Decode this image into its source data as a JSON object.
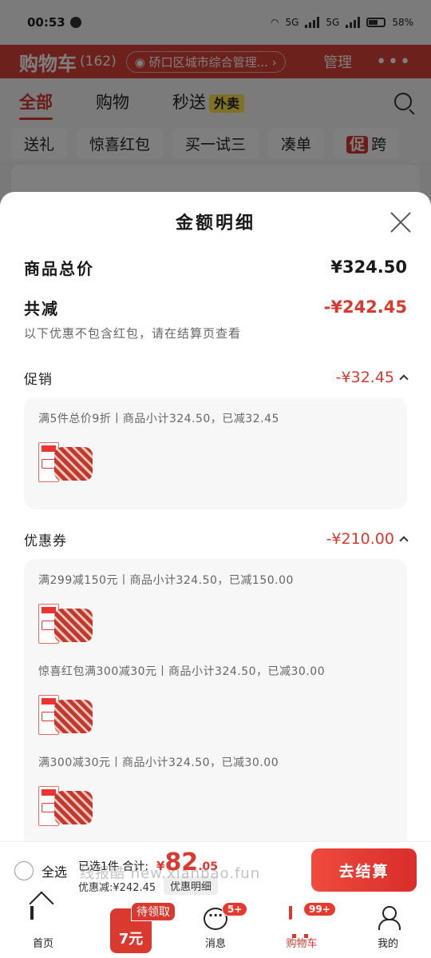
{
  "status_bar": {
    "time": "00:53",
    "network_a": "5G",
    "network_b": "5G",
    "battery": "58%"
  },
  "cart": {
    "title": "购物车",
    "count": "(162)",
    "address": "硚口区城市综合管理...",
    "address_arrow": "›",
    "manage": "管理",
    "more": "•••",
    "tabs": [
      {
        "label": "全部"
      },
      {
        "label": "购物"
      },
      {
        "label": "秒送",
        "badge": "外卖"
      }
    ],
    "filters": [
      "送礼",
      "惊喜红包",
      "买一试三",
      "凑单"
    ],
    "filter_promo_tag": "促",
    "filter_promo_label": "跨"
  },
  "sheet": {
    "title": "金额明细",
    "goods_total_label": "商品总价",
    "goods_total_value": "¥324.50",
    "total_reduce_label": "共减",
    "total_reduce_value": "-¥242.45",
    "note": "以下优惠不包含红包，请在结算页查看",
    "promo": {
      "label": "促销",
      "value": "-¥32.45",
      "items": [
        {
          "text": "满5件总价9折丨商品小计324.50，已减32.45"
        }
      ]
    },
    "coupon": {
      "label": "优惠券",
      "value": "-¥210.00",
      "items": [
        {
          "text": "满299减150元丨商品小计324.50，已减150.00"
        },
        {
          "text": "惊喜红包满300减30元丨商品小计324.50，已减30.00"
        },
        {
          "text": "满300减30元丨商品小计324.50，已减30.00"
        }
      ]
    }
  },
  "checkout": {
    "select_all": "全选",
    "selected": "已选1件 合计:",
    "currency": "¥",
    "amount_int": "82",
    "amount_dec": ".05",
    "discount": "优惠减:¥242.45",
    "detail_button": "优惠明细",
    "checkout_button": "去结算",
    "watermark": "线报酷 new.xianbao.fun"
  },
  "nav": {
    "items": [
      {
        "label": "首页"
      },
      {
        "label": ""
      },
      {
        "label": "消息",
        "badge": "5+"
      },
      {
        "label": "购物车",
        "badge": "99+"
      },
      {
        "label": "我的"
      }
    ],
    "gift_tag": "待领取",
    "gift_amount": "7元"
  },
  "colors": {
    "accent": "#d9392f",
    "waimai_badge": "#ffe24d"
  }
}
